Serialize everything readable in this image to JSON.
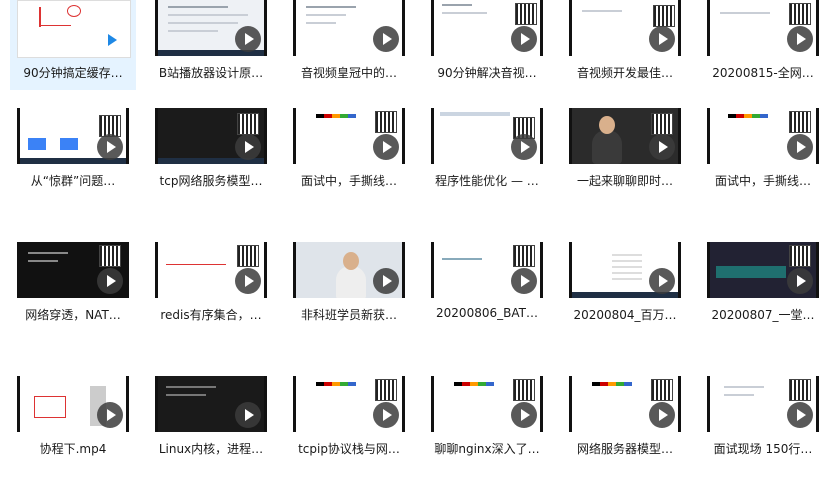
{
  "files": [
    {
      "name": "90分钟搞定缓存…",
      "selected": true
    },
    {
      "name": "B站播放器设计原…"
    },
    {
      "name": "音视频皇冠中的…"
    },
    {
      "name": "90分钟解决音视…"
    },
    {
      "name": "音视频开发最佳…"
    },
    {
      "name": "20200815-全网…"
    },
    {
      "name": "从“惊群”问题…"
    },
    {
      "name": "tcp网络服务模型…"
    },
    {
      "name": "面试中，手撕线…"
    },
    {
      "name": "程序性能优化 — …"
    },
    {
      "name": "一起来聊聊即时…"
    },
    {
      "name": "面试中，手撕线…"
    },
    {
      "name": "网络穿透，NAT…"
    },
    {
      "name": "redis有序集合，…"
    },
    {
      "name": "非科班学员新获…"
    },
    {
      "name": "20200806_BAT…"
    },
    {
      "name": "20200804_百万…"
    },
    {
      "name": "20200807_一堂…"
    },
    {
      "name": "协程下.mp4"
    },
    {
      "name": "Linux内核，进程…"
    },
    {
      "name": "tcpip协议栈与网…"
    },
    {
      "name": "聊聊nginx深入了…"
    },
    {
      "name": "网络服务器模型…"
    },
    {
      "name": "面试现场 150行…"
    }
  ]
}
